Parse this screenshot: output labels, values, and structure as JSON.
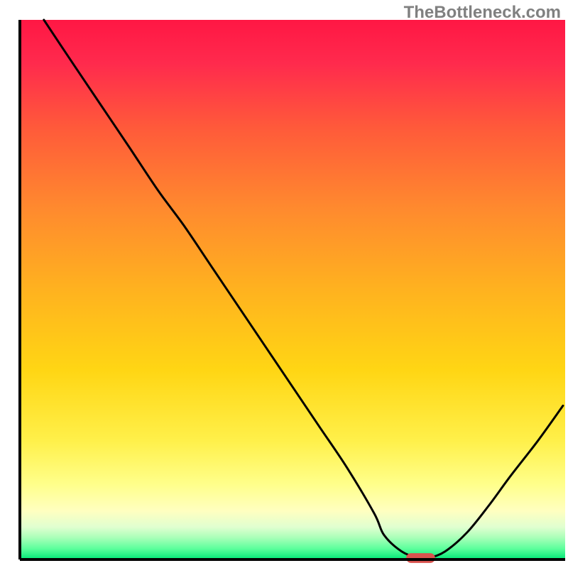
{
  "watermark": "TheBottleneck.com",
  "chart_data": {
    "type": "line",
    "title": "",
    "xlabel": "",
    "ylabel": "",
    "xlim": [
      0,
      100
    ],
    "ylim": [
      0,
      100
    ],
    "gradient_stops": [
      {
        "offset": 0.0,
        "color": "#ff1744"
      },
      {
        "offset": 0.08,
        "color": "#ff2a4d"
      },
      {
        "offset": 0.2,
        "color": "#ff5a3a"
      },
      {
        "offset": 0.35,
        "color": "#ff8a2e"
      },
      {
        "offset": 0.5,
        "color": "#ffb21f"
      },
      {
        "offset": 0.65,
        "color": "#ffd614"
      },
      {
        "offset": 0.78,
        "color": "#fff04a"
      },
      {
        "offset": 0.86,
        "color": "#ffff8a"
      },
      {
        "offset": 0.91,
        "color": "#ffffc0"
      },
      {
        "offset": 0.94,
        "color": "#e0ffd0"
      },
      {
        "offset": 0.96,
        "color": "#a8ffb8"
      },
      {
        "offset": 0.98,
        "color": "#5cff9c"
      },
      {
        "offset": 1.0,
        "color": "#00e676"
      }
    ],
    "series": [
      {
        "name": "bottleneck-curve",
        "x": [
          4.4,
          10,
          15,
          20,
          25.4,
          30,
          35,
          40,
          45,
          50,
          55,
          60,
          65,
          66.8,
          70,
          73,
          75,
          78,
          82,
          86,
          90,
          95,
          99.6
        ],
        "values": [
          100,
          91.5,
          84,
          76.5,
          68.3,
          62,
          54.5,
          47,
          39.5,
          32,
          24.5,
          17,
          8.5,
          4.5,
          1.5,
          0.3,
          0.3,
          1.5,
          5,
          10,
          15.5,
          22,
          28.5
        ]
      }
    ],
    "marker": {
      "name": "optimal-point",
      "x": 73.5,
      "y": 0,
      "width_pct": 5.3,
      "height_pct": 1.8,
      "color": "#d9534f"
    },
    "axes": {
      "stroke": "#000000",
      "stroke_width": 4
    }
  }
}
